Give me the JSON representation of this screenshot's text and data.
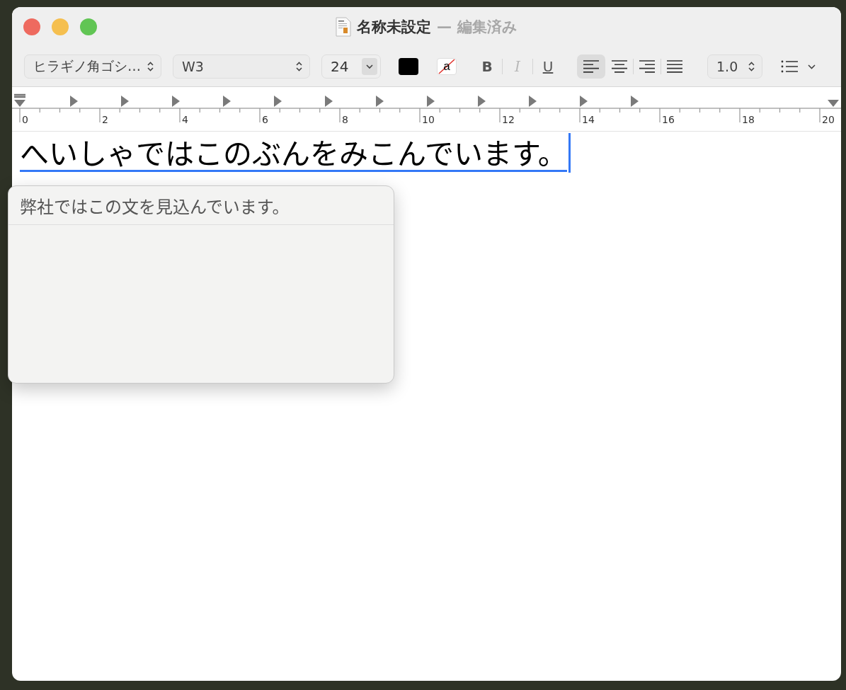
{
  "window": {
    "title": "名称未設定",
    "separator": "—",
    "status": "編集済み"
  },
  "toolbar": {
    "font_family": "ヒラギノ角ゴシ…",
    "font_weight": "W3",
    "font_size": "24",
    "style_buttons": [
      {
        "label": "B",
        "kind": "bold",
        "disabled": false
      },
      {
        "label": "I",
        "kind": "italic",
        "disabled": true
      },
      {
        "label": "U",
        "kind": "underline",
        "disabled": false
      }
    ],
    "alignment": [
      {
        "kind": "left",
        "selected": true
      },
      {
        "kind": "center",
        "selected": false
      },
      {
        "kind": "right",
        "selected": false
      },
      {
        "kind": "justify",
        "selected": false
      }
    ],
    "line_spacing": "1.0",
    "background_color_glyph": "a"
  },
  "ruler": {
    "labels": [
      "0",
      "2",
      "4",
      "6",
      "8",
      "10",
      "12",
      "14",
      "16",
      "18",
      "20"
    ]
  },
  "document": {
    "text": "へいしゃではこのぶんをみこんでいます。",
    "marked": true
  },
  "candidates": [
    {
      "text": "弊社ではこの文を見込んでいます。"
    }
  ]
}
